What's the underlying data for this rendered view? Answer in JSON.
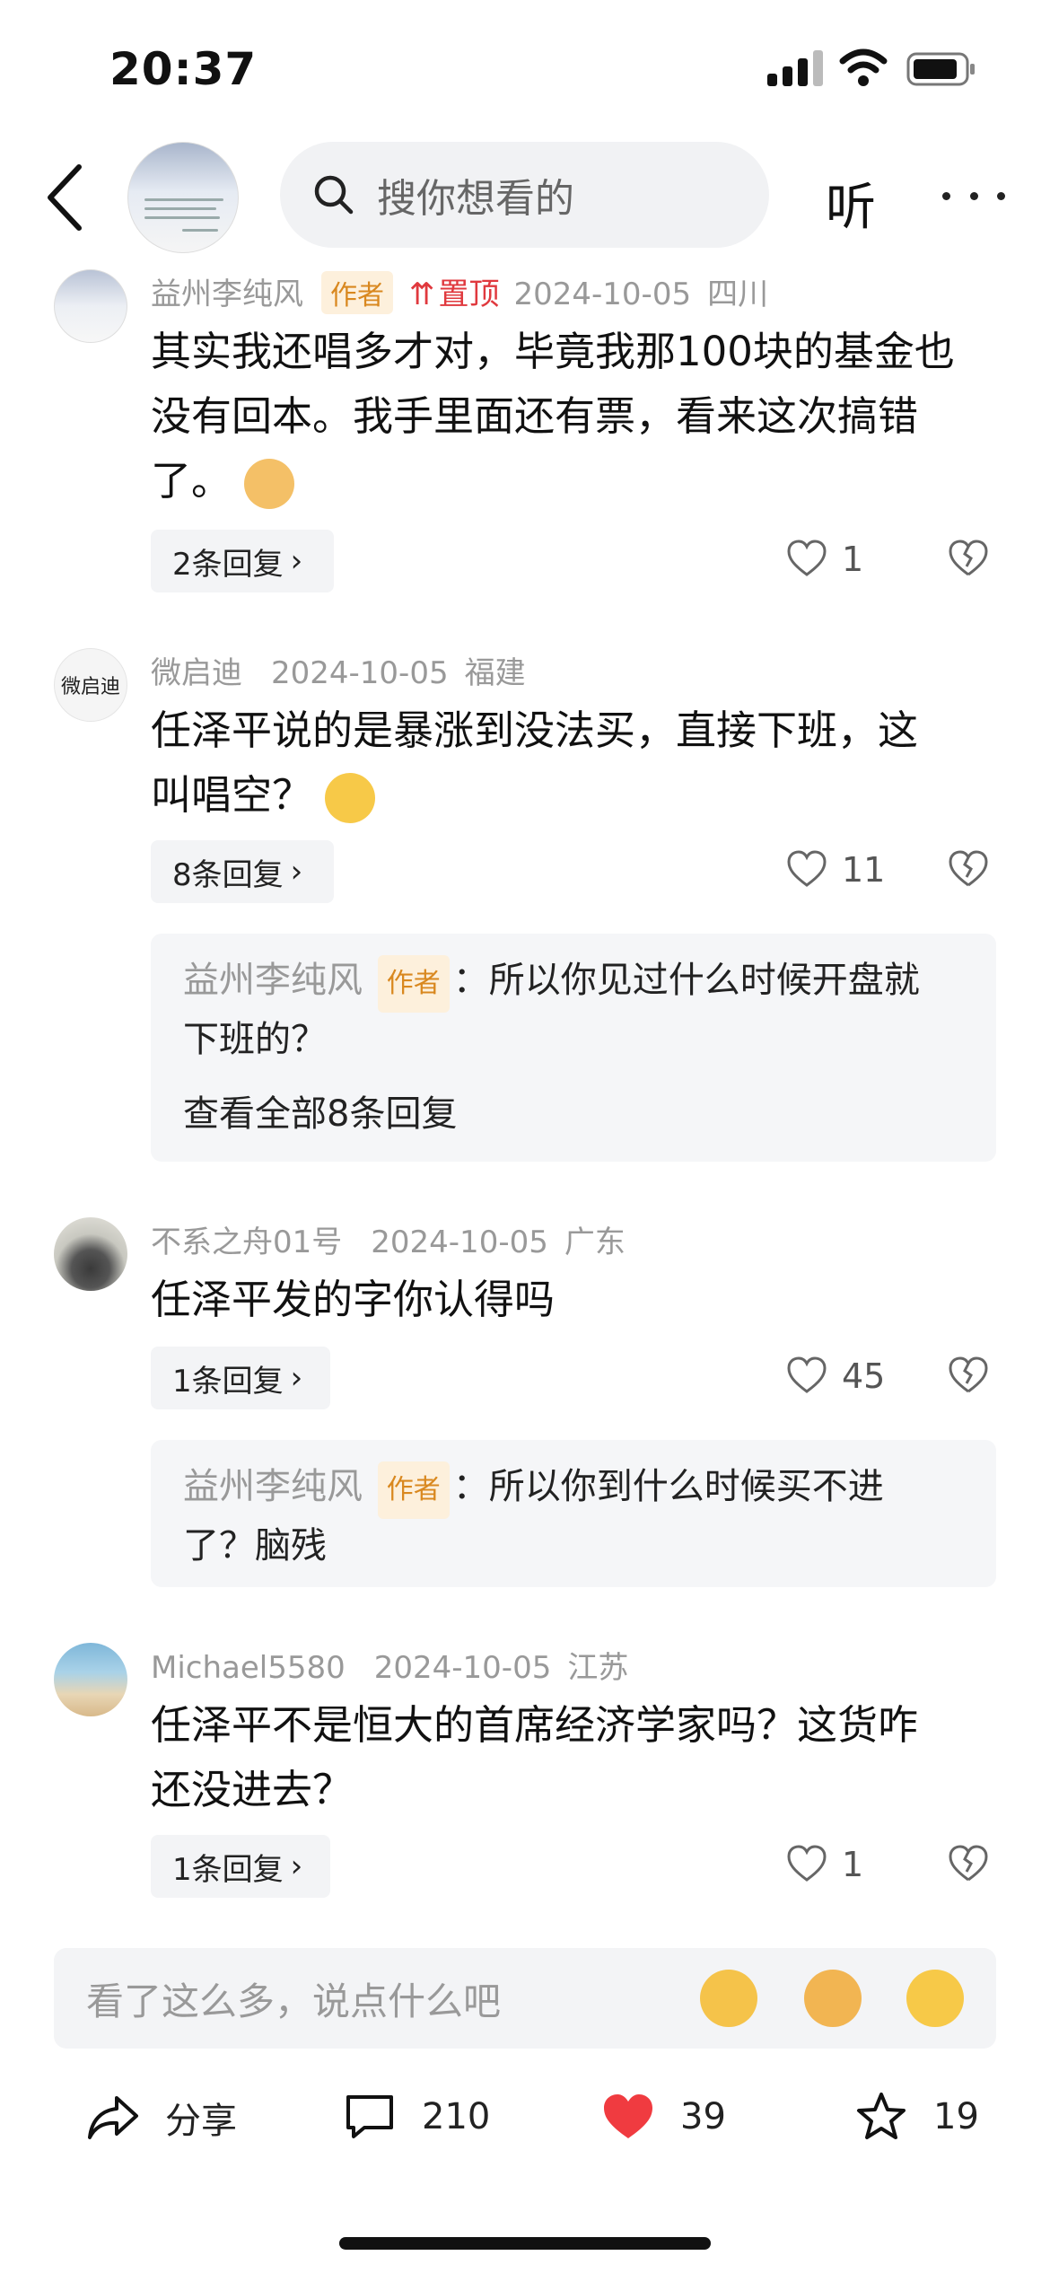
{
  "status_bar": {
    "time": "20:37"
  },
  "header": {
    "search_placeholder": "搜你想看的",
    "listen_label": "听"
  },
  "comments": [
    {
      "user": "益州李纯风",
      "author_badge": "作者",
      "pinned_label": "置顶",
      "date": "2024-10-05",
      "location": "四川",
      "text_line1": "其实我还唱多才对，毕竟我那100块的基金也",
      "text_line2": "没有回本。我手里面还有票，看来这次搞错",
      "text_line3": "了。",
      "replies_label": "2条回复",
      "likes": "1"
    },
    {
      "user": "微启迪",
      "avatar_text": "微启迪",
      "date": "2024-10-05",
      "location": "福建",
      "text_line1": "任泽平说的是暴涨到没法买，直接下班，这",
      "text_line2": "叫唱空？",
      "replies_label": "8条回复",
      "likes": "11",
      "sub_reply": {
        "user": "益州李纯风",
        "badge": "作者",
        "text_line1": "：所以你见过什么时候开盘就",
        "text_line2": "下班的？",
        "view_all": "查看全部8条回复"
      }
    },
    {
      "user": "不系之舟01号",
      "date": "2024-10-05",
      "location": "广东",
      "text_line1": "任泽平发的字你认得吗",
      "replies_label": "1条回复",
      "likes": "45",
      "sub_reply": {
        "user": "益州李纯风",
        "badge": "作者",
        "text_line1": "：所以你到什么时候买不进",
        "text_line2": "了？脑残"
      }
    },
    {
      "user": "Michael5580",
      "date": "2024-10-05",
      "location": "江苏",
      "text_line1": "任泽平不是恒大的首席经济学家吗？这货咋",
      "text_line2": "还没进去？",
      "replies_label": "1条回复",
      "likes": "1"
    }
  ],
  "input_bar": {
    "placeholder": "看了这么多，说点什么吧"
  },
  "bottom_bar": {
    "share_label": "分享",
    "comment_count": "210",
    "like_count": "39",
    "favorite_count": "19"
  },
  "colors": {
    "accent_red": "#f03b40",
    "badge_bg": "#fdf0dc",
    "badge_text": "#d9881f",
    "meta_gray": "#999999"
  }
}
